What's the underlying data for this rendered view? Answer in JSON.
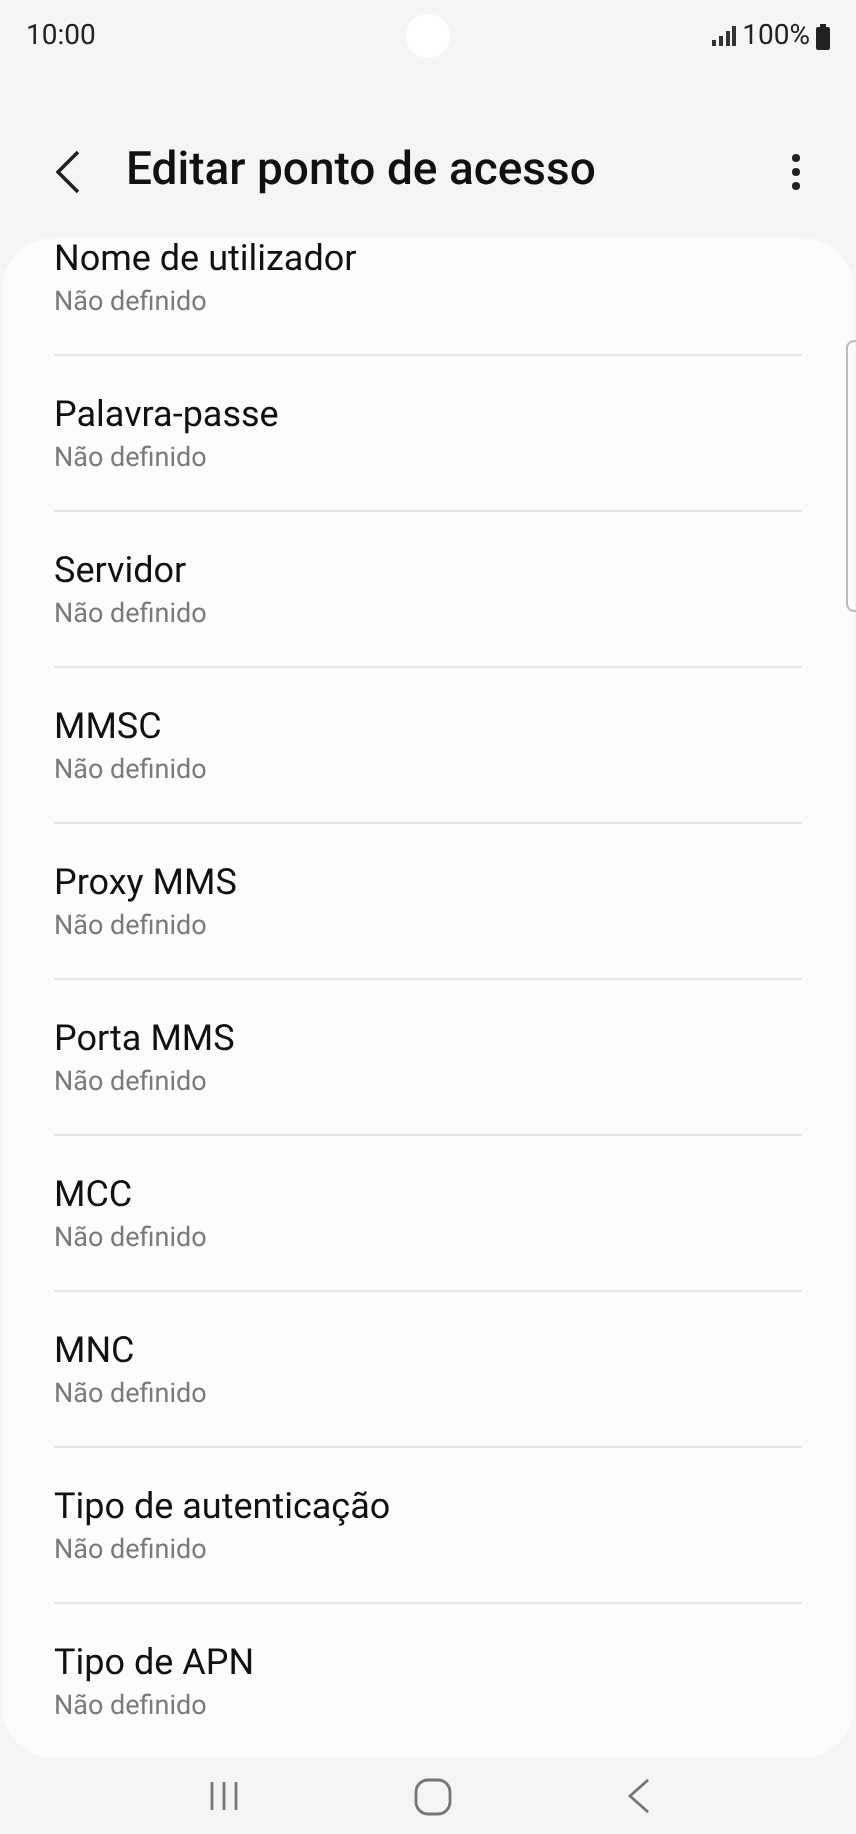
{
  "status_bar": {
    "time": "10:00",
    "battery": "100%"
  },
  "header": {
    "title": "Editar ponto de acesso"
  },
  "settings": [
    {
      "title": "Nome de utilizador",
      "value": "Não definido"
    },
    {
      "title": "Palavra-passe",
      "value": "Não definido"
    },
    {
      "title": "Servidor",
      "value": "Não definido"
    },
    {
      "title": "MMSC",
      "value": "Não definido"
    },
    {
      "title": "Proxy MMS",
      "value": "Não definido"
    },
    {
      "title": "Porta MMS",
      "value": "Não definido"
    },
    {
      "title": "MCC",
      "value": "Não definido"
    },
    {
      "title": "MNC",
      "value": "Não definido"
    },
    {
      "title": "Tipo de autenticação",
      "value": "Não definido"
    },
    {
      "title": "Tipo de APN",
      "value": "Não definido"
    }
  ]
}
